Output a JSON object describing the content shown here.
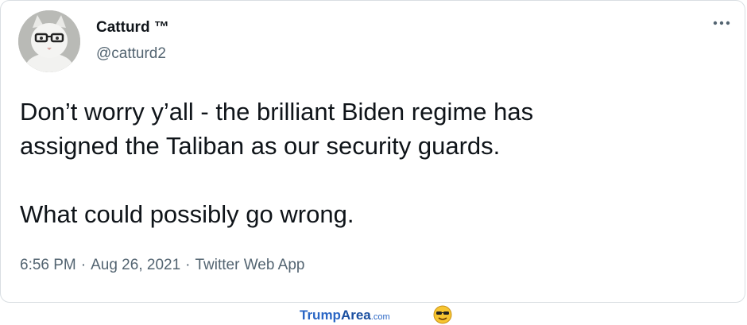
{
  "tweet": {
    "display_name": "Catturd ™",
    "handle": "@catturd2",
    "more_icon": "more-options-icon",
    "text": "Don’t worry y’all - the brilliant Biden regime has\nassigned the Taliban as our security guards.\n\nWhat could possibly go wrong.",
    "time": "6:56 PM",
    "date": "Aug 26, 2021",
    "source": "Twitter Web App",
    "separator": "·"
  },
  "watermark": {
    "part1": "Trump",
    "part2": "Area",
    "part3": ".com",
    "emoji_icon": "face-with-sunglasses-icon"
  },
  "colors": {
    "text": "#0f1419",
    "secondary": "#536471",
    "border": "#d9dee2",
    "watermark_blue": "#2a66c5"
  }
}
